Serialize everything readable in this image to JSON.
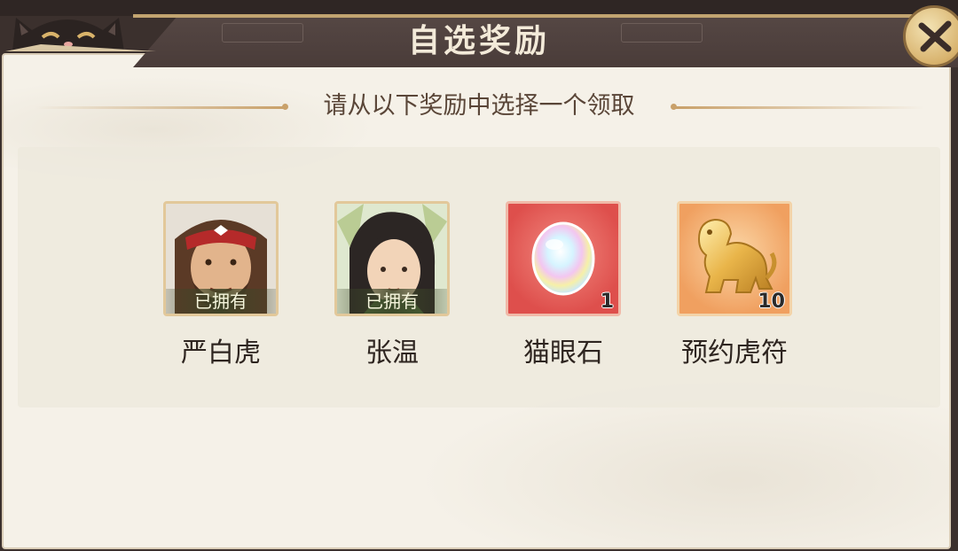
{
  "window": {
    "title": "自选奖励",
    "subtitle": "请从以下奖励中选择一个领取"
  },
  "rewards": [
    {
      "name": "严白虎",
      "badge": "已拥有",
      "quantity": "",
      "icon": "yan-baihu-portrait-icon"
    },
    {
      "name": "张温",
      "badge": "已拥有",
      "quantity": "",
      "icon": "zhang-wen-portrait-icon"
    },
    {
      "name": "猫眼石",
      "badge": "",
      "quantity": "1",
      "icon": "cats-eye-gem-icon"
    },
    {
      "name": "预约虎符",
      "badge": "",
      "quantity": "10",
      "icon": "golden-tiger-tally-icon"
    }
  ],
  "colors": {
    "header": "#4a3c39",
    "panel": "#f5f1e8",
    "accent_gold": "#c9a16a",
    "text_dark": "#2e2520",
    "gem_card_bg": "#e25a55",
    "tiger_card_bg": "#f0a060"
  }
}
